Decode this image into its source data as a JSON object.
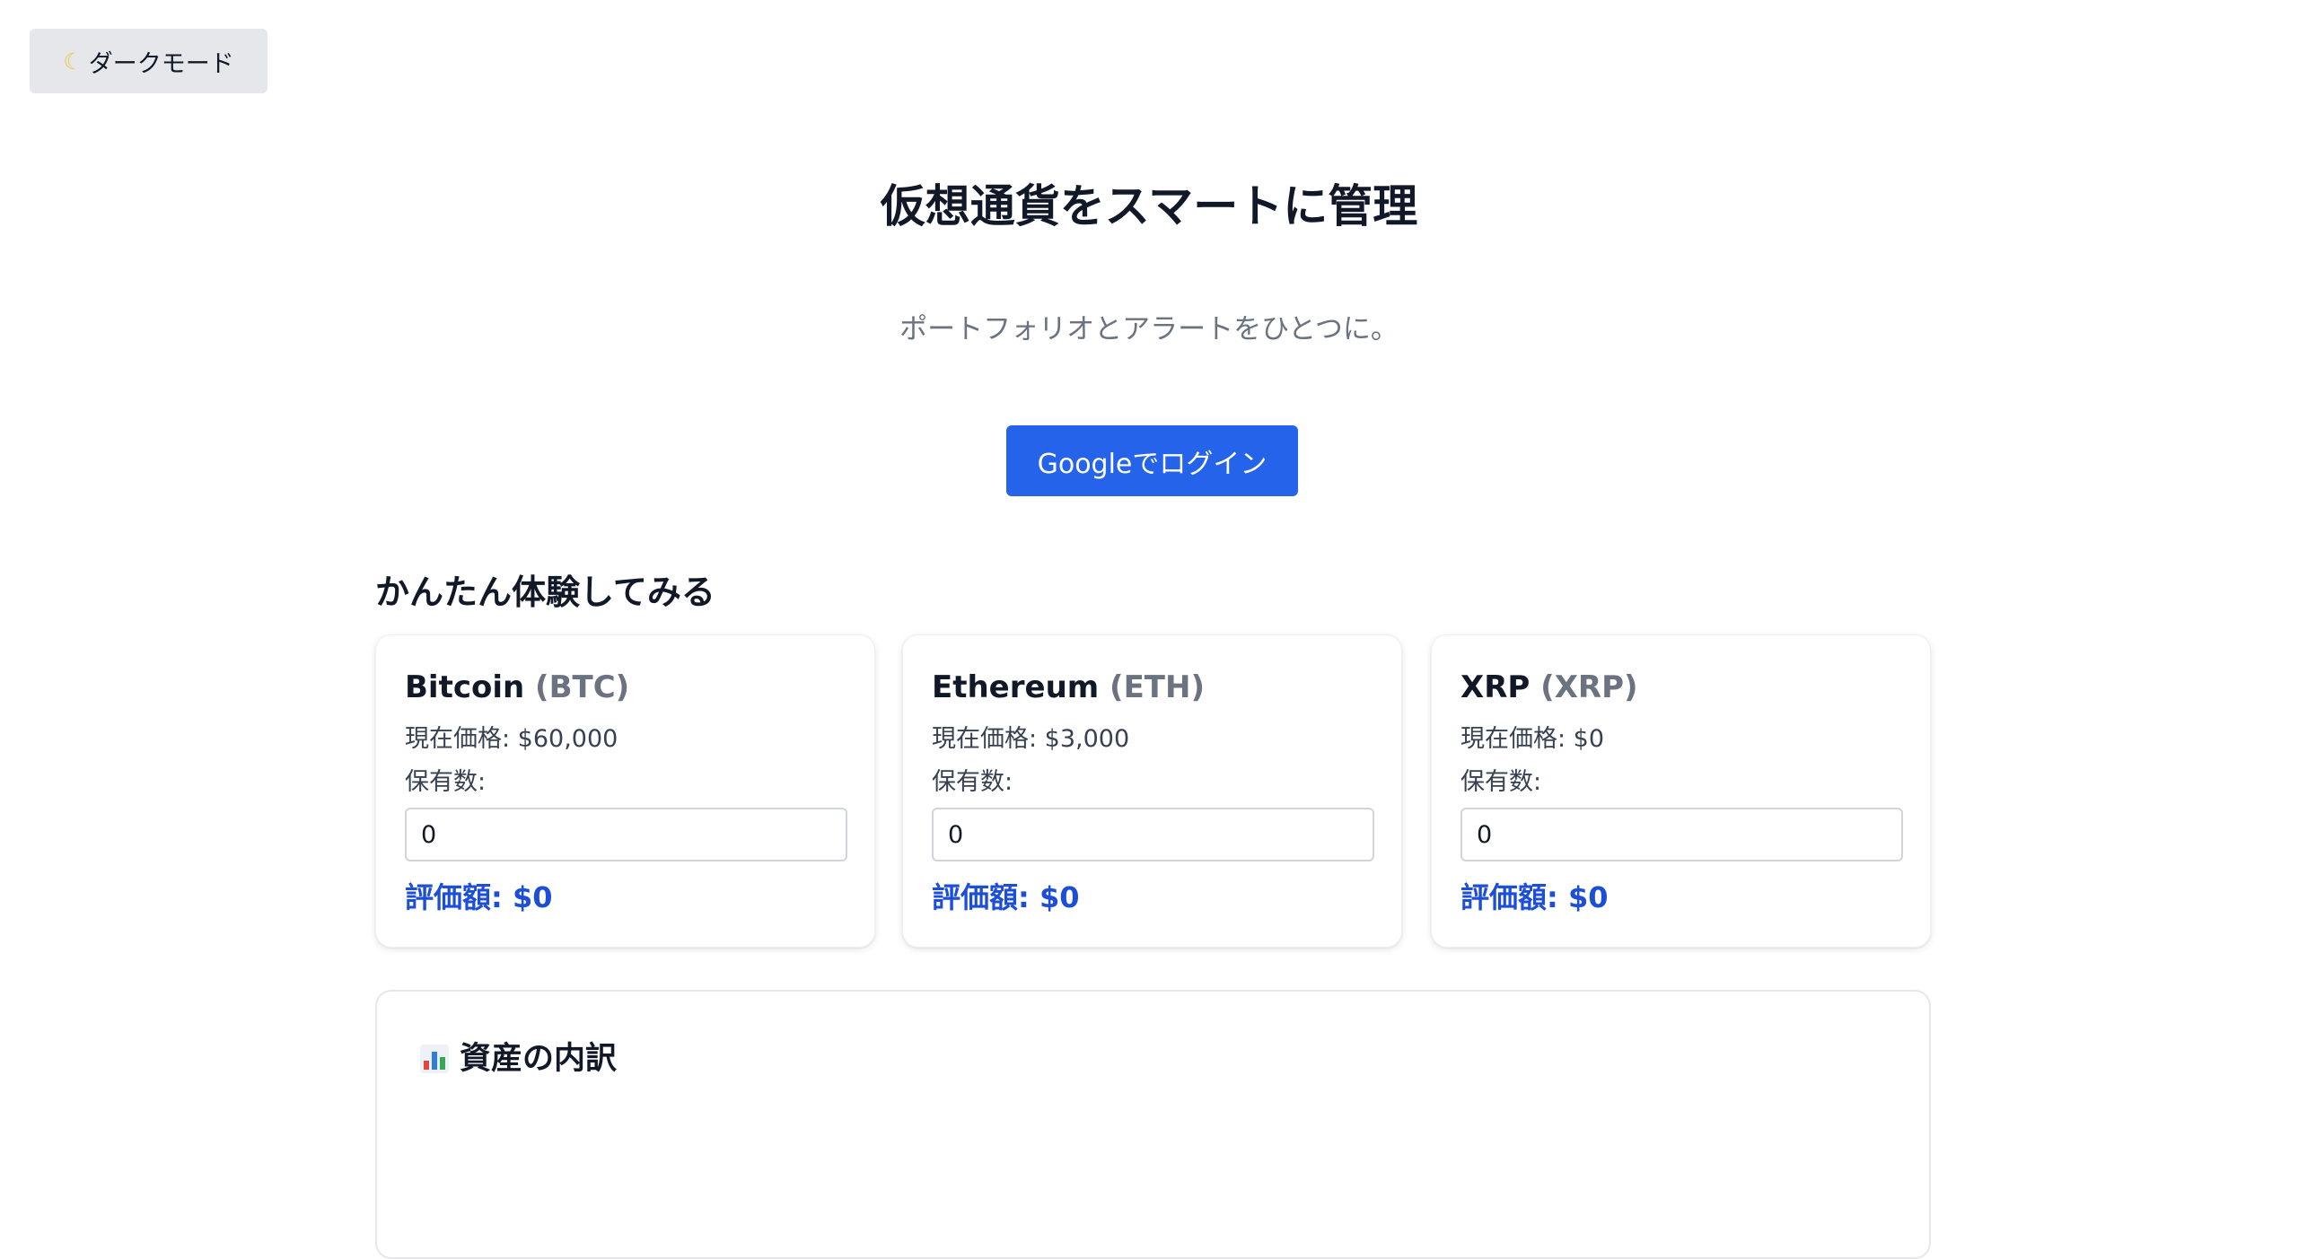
{
  "theme_toggle": {
    "icon": "moon-icon",
    "label": "ダークモード"
  },
  "hero": {
    "title": "仮想通貨をスマートに管理",
    "subtitle": "ポートフォリオとアラートをひとつに。",
    "login_label": "Googleでログイン"
  },
  "demo": {
    "section_title": "かんたん体験してみる",
    "holdings_label": "保有数:",
    "coins": [
      {
        "name": "Bitcoin",
        "symbol": "(BTC)",
        "price_text": "現在価格: $60,000",
        "quantity": "0",
        "value_text": "評価額: $0"
      },
      {
        "name": "Ethereum",
        "symbol": "(ETH)",
        "price_text": "現在価格: $3,000",
        "quantity": "0",
        "value_text": "評価額: $0"
      },
      {
        "name": "XRP",
        "symbol": "(XRP)",
        "price_text": "現在価格: $0",
        "quantity": "0",
        "value_text": "評価額: $0"
      }
    ]
  },
  "breakdown": {
    "icon": "bar-chart-icon",
    "title": "資産の内訳"
  },
  "colors": {
    "primary": "#2563eb",
    "value_text": "#1d4ed8",
    "muted_text": "#6b7280",
    "toggle_bg": "#e5e7eb"
  }
}
